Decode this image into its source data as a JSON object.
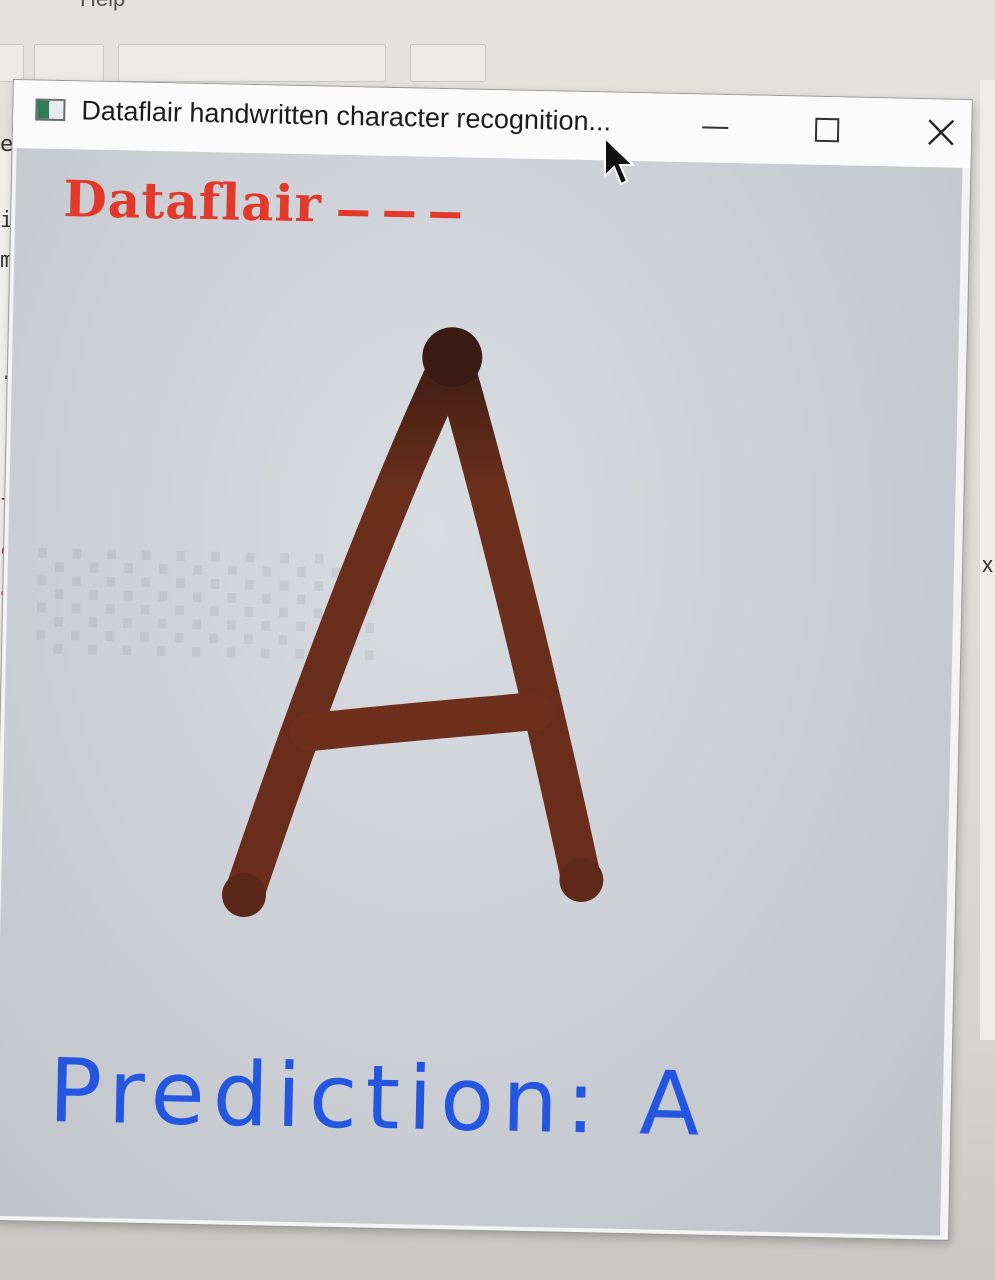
{
  "background_app": {
    "menu_fragment": "Help",
    "code_margin_chars": [
      "e",
      "i",
      "m",
      ".",
      "l",
      "c",
      "a",
      "&"
    ],
    "right_edge_char": "x"
  },
  "window": {
    "title": "Dataflair handwritten character recognition...",
    "controls": {
      "minimize_icon": "minimize-icon",
      "maximize_icon": "maximize-icon",
      "close_icon": "close-icon"
    }
  },
  "canvas": {
    "brand_text": "Dataflair",
    "drawn_character": "A",
    "prediction_label": "Prediction:",
    "prediction_value": "A"
  },
  "colors": {
    "brand": "#e2392a",
    "prediction": "#2456e0",
    "ink": "#6b2e1c"
  }
}
